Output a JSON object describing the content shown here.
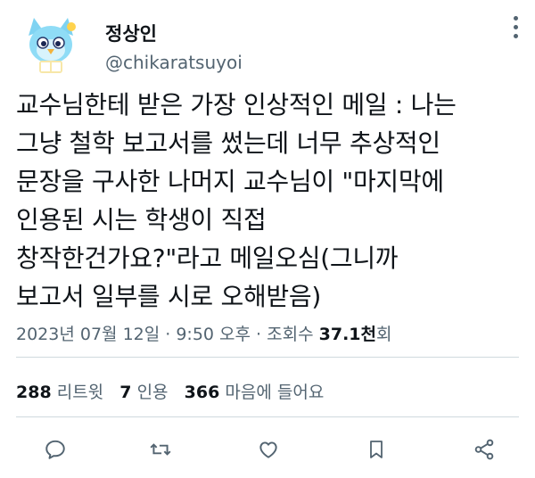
{
  "user": {
    "display_name": "정상인",
    "handle": "@chikaratsuyoi"
  },
  "tweet": {
    "text": "교수님한테 받은 가장 인상적인 메일 : 나는\n그냥 철학 보고서를 썼는데 너무 추상적인\n문장을 구사한 나머지 교수님이 \"마지막에\n인용된 시는 학생이 직접\n창작한건가요?\"라고 메일오심(그니까\n보고서 일부를 시로 오해받음)"
  },
  "meta": {
    "timestamp": "2023년 07월 12일 · 9:50 오후 · 조회수",
    "views": "37.1천",
    "views_suffix": "회"
  },
  "stats": {
    "retweets_count": "288",
    "retweets_label": "리트윗",
    "quotes_count": "7",
    "quotes_label": "인용",
    "likes_count": "366",
    "likes_label": "마음에 들어요"
  },
  "icons": [
    "more-options-icon",
    "reply-icon",
    "retweet-icon",
    "like-icon",
    "bookmark-icon",
    "share-icon"
  ],
  "colors": {
    "text": "#0f1419",
    "secondary": "#536471",
    "divider": "#cfd9de"
  }
}
